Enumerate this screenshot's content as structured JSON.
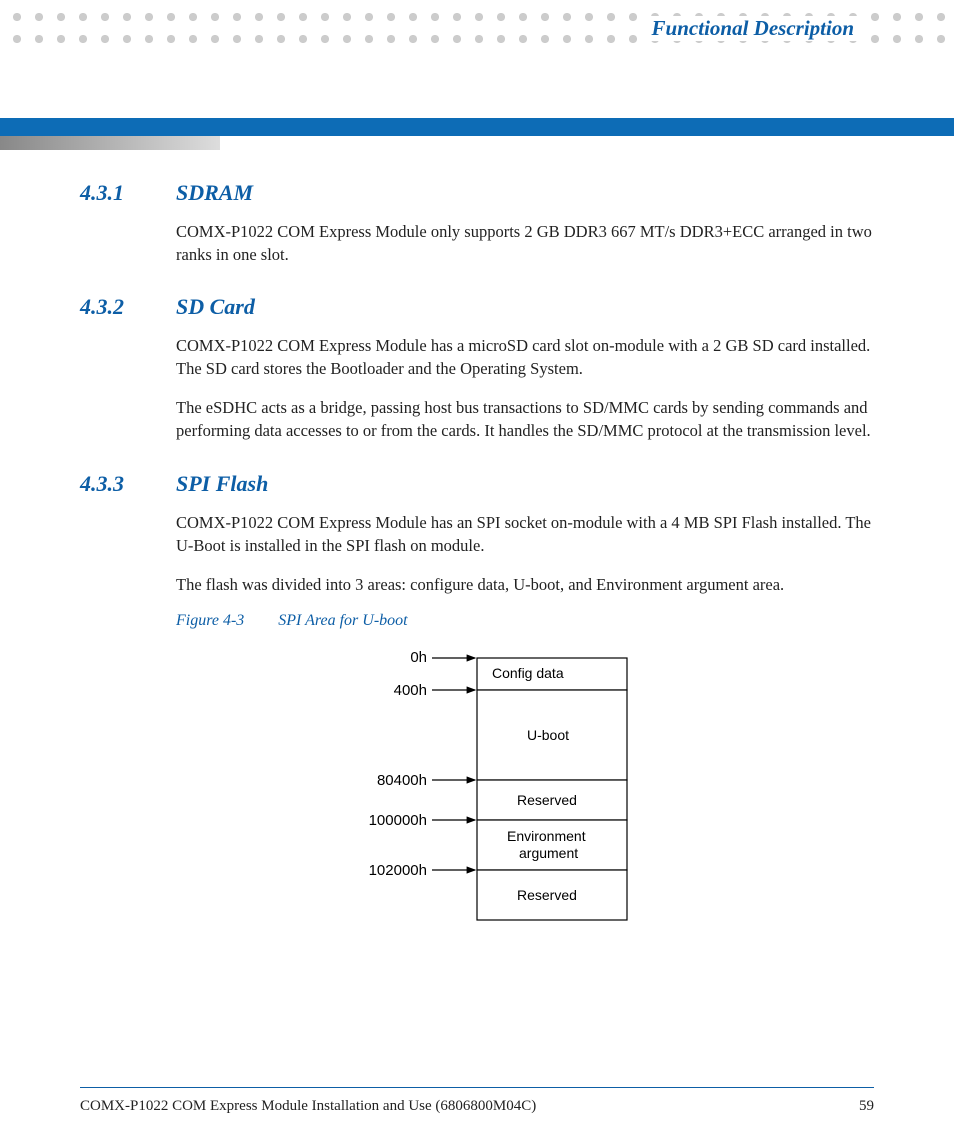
{
  "header": {
    "title": "Functional Description"
  },
  "sections": [
    {
      "num": "4.3.1",
      "title": "SDRAM",
      "paras": [
        "COMX-P1022 COM Express Module only supports 2 GB DDR3 667 MT/s DDR3+ECC arranged in two ranks in one slot."
      ]
    },
    {
      "num": "4.3.2",
      "title": "SD Card",
      "paras": [
        "COMX-P1022 COM Express Module has a microSD card slot on-module with a 2 GB SD card installed. The SD card stores the Bootloader and the Operating System.",
        "The eSDHC acts as a bridge, passing host bus transactions to SD/MMC cards by sending commands and performing data accesses to or from the cards. It handles the SD/MMC protocol at the transmission level."
      ]
    },
    {
      "num": "4.3.3",
      "title": "SPI Flash",
      "paras": [
        "COMX-P1022 COM Express Module has an SPI socket on-module with a 4 MB SPI Flash installed. The U-Boot is installed in the SPI flash on module.",
        "The flash was divided into 3 areas: configure data, U-boot, and Environment argument area."
      ]
    }
  ],
  "figure": {
    "num": "Figure 4-3",
    "title": "SPI Area for U-boot",
    "map": {
      "addresses": [
        "0h",
        "400h",
        "80400h",
        "100000h",
        "102000h"
      ],
      "regions": [
        "Config data",
        "U-boot",
        "Reserved",
        "Environment argument",
        "Reserved"
      ]
    }
  },
  "footer": {
    "doc": "COMX-P1022 COM Express Module Installation and Use (6806800M04C)",
    "page": "59"
  }
}
